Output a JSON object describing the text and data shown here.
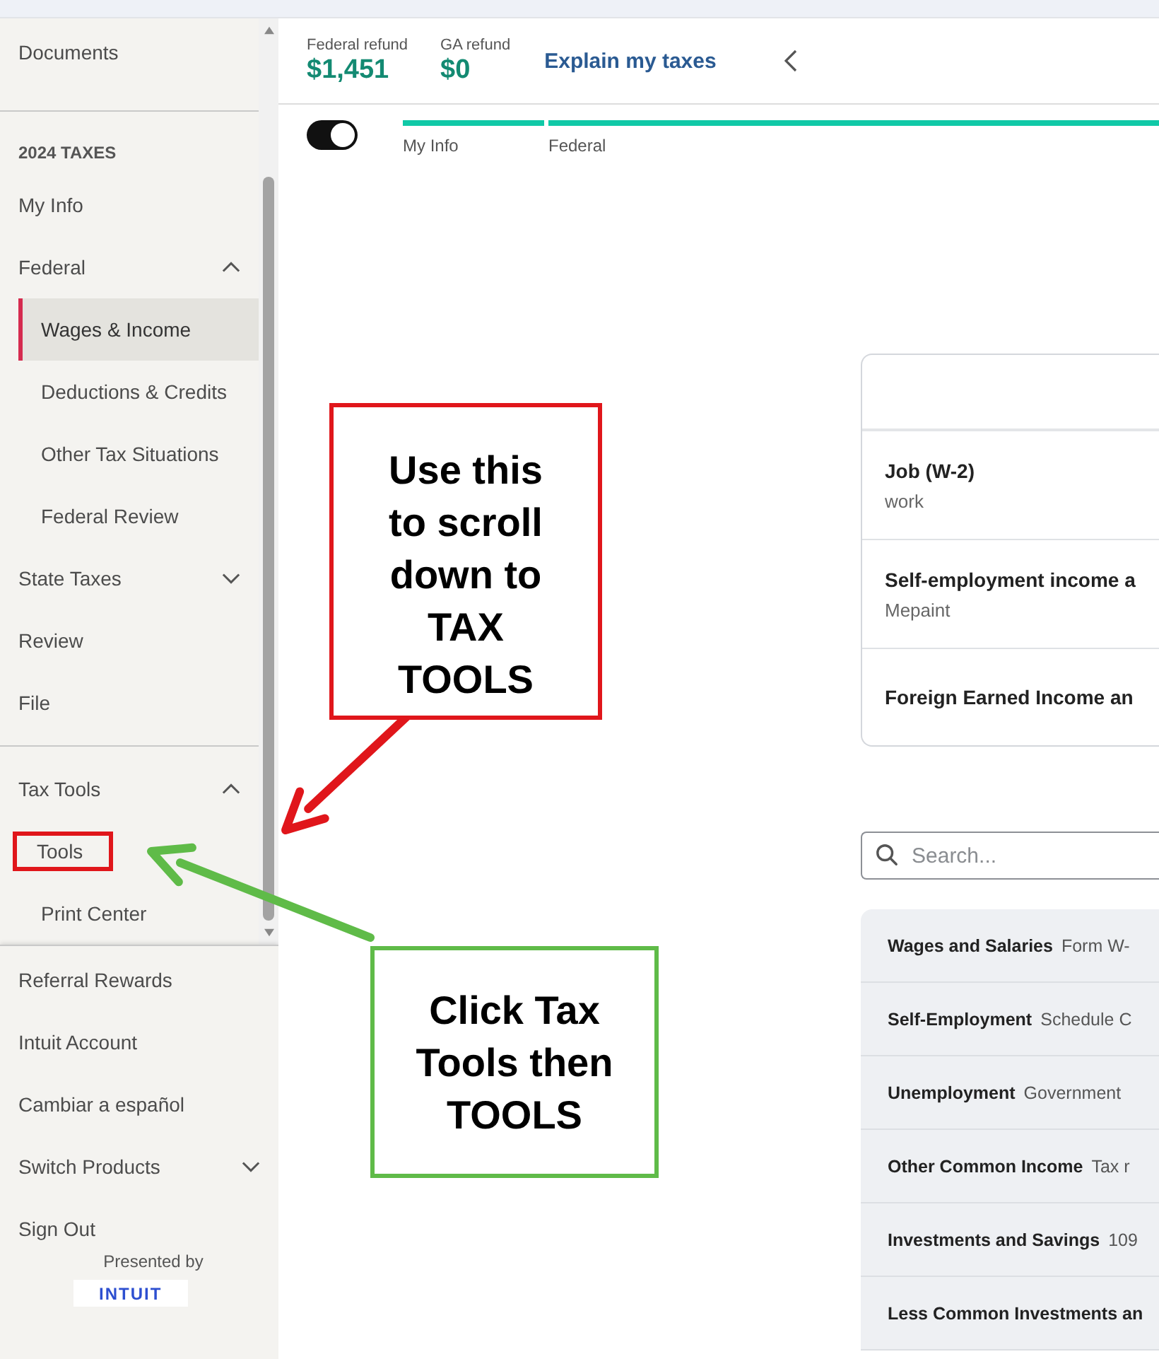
{
  "sidebar": {
    "groups": [
      {
        "items": [
          {
            "label": "Documents",
            "selected": false,
            "highlighted": false
          }
        ]
      },
      {
        "title": "2024 TAXES",
        "items": [
          {
            "label": "My Info",
            "selected": false,
            "highlighted": false
          },
          {
            "label": "Federal",
            "selected": false,
            "highlighted": false,
            "expanded": true,
            "children": [
              {
                "label": "Wages & Income",
                "selected": true,
                "highlighted": false
              },
              {
                "label": "Deductions & Credits",
                "selected": false,
                "highlighted": false
              },
              {
                "label": "Other Tax Situations",
                "selected": false,
                "highlighted": false
              },
              {
                "label": "Federal Review",
                "selected": false,
                "highlighted": false
              }
            ]
          },
          {
            "label": "State Taxes",
            "selected": false,
            "highlighted": false,
            "expanded": false
          },
          {
            "label": "Review",
            "selected": false,
            "highlighted": false
          },
          {
            "label": "File",
            "selected": false,
            "highlighted": false
          }
        ]
      },
      {
        "items": [
          {
            "label": "Tax Tools",
            "selected": false,
            "highlighted": false,
            "expanded": true,
            "children": [
              {
                "label": "Tools",
                "selected": false,
                "highlighted": true
              },
              {
                "label": "Print Center",
                "selected": false,
                "highlighted": false
              }
            ]
          }
        ]
      }
    ],
    "bottom": {
      "items": [
        {
          "label": "Referral Rewards",
          "selected": false,
          "highlighted": false
        },
        {
          "label": "Intuit Account",
          "selected": false,
          "highlighted": false
        },
        {
          "label": "Cambiar a español",
          "selected": false,
          "highlighted": false
        },
        {
          "label": "Switch Products",
          "selected": false,
          "highlighted": false,
          "expanded": false
        },
        {
          "label": "Sign Out",
          "selected": false,
          "highlighted": false
        }
      ],
      "presented_by": "Presented by",
      "logo": "INTUIT"
    }
  },
  "header": {
    "refunds": [
      {
        "label": "Federal refund",
        "amount": "$1,451"
      },
      {
        "label": "GA refund",
        "amount": "$0"
      }
    ],
    "explain_link": "Explain my taxes"
  },
  "toggle": {
    "on": true
  },
  "progress": [
    {
      "label": "My Info",
      "level": 1
    },
    {
      "label": "Federal",
      "level": 1
    }
  ],
  "income_card": {
    "rows": [
      {
        "title": "Job (W-2)",
        "subtitle": "work"
      },
      {
        "title": "Self-employment income a",
        "subtitle": "Mepaint"
      },
      {
        "title": "Foreign Earned Income an"
      }
    ]
  },
  "search": {
    "placeholder": "Search..."
  },
  "categories": [
    {
      "title": "Wages and Salaries",
      "description": "Form W-"
    },
    {
      "title": "Self-Employment",
      "description": "Schedule C"
    },
    {
      "title": "Unemployment",
      "description": "Government"
    },
    {
      "title": "Other Common Income",
      "description": "Tax r"
    },
    {
      "title": "Investments and Savings",
      "description": "109"
    },
    {
      "title": "Less Common Investments an"
    }
  ],
  "annotations": [
    {
      "kind": "callout",
      "text": "Use this\nto scroll\ndown to\nTAX\nTOOLS",
      "color": "#e0161b",
      "arrow": true
    },
    {
      "kind": "callout",
      "text": "Click Tax\nTools then\nTOOLS",
      "color": "#5fbb48",
      "arrow": true
    }
  ]
}
